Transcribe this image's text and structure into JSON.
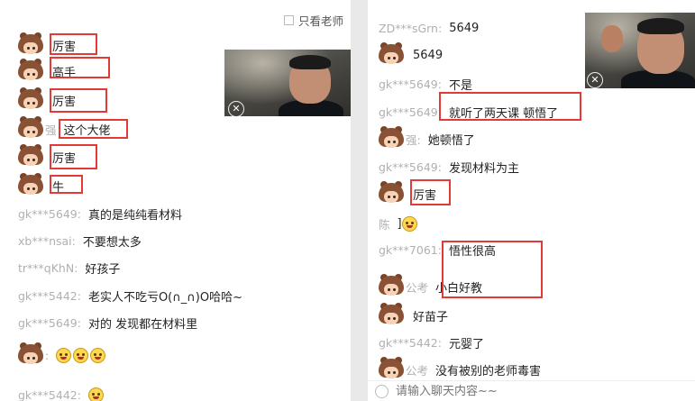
{
  "left": {
    "filter_label": "只看老师",
    "messages": [
      {
        "avatar": true,
        "user": "",
        "text": "厉害"
      },
      {
        "avatar": true,
        "user": "",
        "text": "高手"
      },
      {
        "avatar": true,
        "user": "",
        "text": "厉害"
      },
      {
        "avatar": true,
        "user": "强",
        "text": "这个大佬"
      },
      {
        "avatar": true,
        "user": "",
        "text": "厉害"
      },
      {
        "avatar": true,
        "user": "",
        "text": "牛"
      },
      {
        "avatar": false,
        "user": "gk***5649:",
        "text": "真的是纯纯看材料"
      },
      {
        "avatar": false,
        "user": "xb***nsai:",
        "text": "不要想太多"
      },
      {
        "avatar": false,
        "user": "tr***qKhN:",
        "text": "好孩子"
      },
      {
        "avatar": false,
        "user": "gk***5442:",
        "text": "老实人不吃亏O(∩_∩)O哈哈~"
      },
      {
        "avatar": false,
        "user": "gk***5649:",
        "text": "对的 发现都在材料里"
      },
      {
        "avatar": true,
        "user": ":",
        "text": ""
      },
      {
        "avatar": false,
        "user": "gk***5442:",
        "text": ""
      }
    ]
  },
  "right": {
    "messages": [
      {
        "avatar": false,
        "user": "ZD***sGrn:",
        "text": "5649"
      },
      {
        "avatar": true,
        "user": "",
        "text": "5649"
      },
      {
        "avatar": false,
        "user": "gk***5649:",
        "text": "不是"
      },
      {
        "avatar": false,
        "user": "gk***5649:",
        "text": "就听了两天课 顿悟了"
      },
      {
        "avatar": true,
        "user": "强:",
        "text": "她顿悟了"
      },
      {
        "avatar": false,
        "user": "gk***5649:",
        "text": "发现材料为主"
      },
      {
        "avatar": true,
        "user": "",
        "text": "厉害"
      },
      {
        "avatar": false,
        "user": "陈",
        "text": "]"
      },
      {
        "avatar": false,
        "user": "gk***7061:",
        "text": "悟性很高"
      },
      {
        "avatar": true,
        "user": "公考",
        "text": "小白好教"
      },
      {
        "avatar": true,
        "user": "",
        "text": "好苗子"
      },
      {
        "avatar": false,
        "user": "gk***5442:",
        "text": "元婴了"
      },
      {
        "avatar": true,
        "user": "公考",
        "text": "没有被别的老师毒害"
      }
    ],
    "input_placeholder": "请输入聊天内容~~"
  },
  "colors": {
    "highlight": "#e53935",
    "username": "#b0b0b0",
    "text": "#222222"
  },
  "icons": {
    "close": "close-icon",
    "avatar": "cartoon-avatar-icon",
    "emoji": "smile-emoji-icon",
    "input": "emoji-face-icon"
  }
}
